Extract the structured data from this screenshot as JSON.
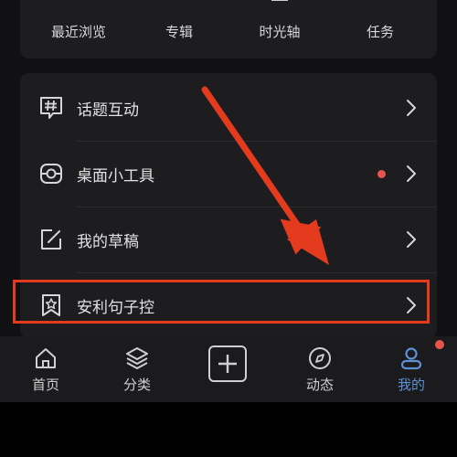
{
  "colors": {
    "accent": "#5e8fd1",
    "badge": "#e5554c",
    "highlight": "#e43a1e"
  },
  "shortcuts": [
    {
      "label": "最近浏览",
      "icon": "history-icon"
    },
    {
      "label": "专辑",
      "icon": "album-icon"
    },
    {
      "label": "时光轴",
      "icon": "timeline-icon"
    },
    {
      "label": "任务",
      "icon": "task-icon"
    }
  ],
  "menu": [
    {
      "label": "话题互动",
      "icon": "topic-icon"
    },
    {
      "label": "桌面小工具",
      "icon": "widget-icon",
      "has_dot": true
    },
    {
      "label": "我的草稿",
      "icon": "draft-icon"
    },
    {
      "label": "安利句子控",
      "icon": "recommend-icon"
    }
  ],
  "nav": [
    {
      "label": "首页",
      "icon": "home-icon"
    },
    {
      "label": "分类",
      "icon": "category-icon"
    },
    {
      "label": "",
      "icon": "add-icon"
    },
    {
      "label": "动态",
      "icon": "compass-icon"
    },
    {
      "label": "我的",
      "icon": "profile-icon",
      "active": true
    }
  ]
}
